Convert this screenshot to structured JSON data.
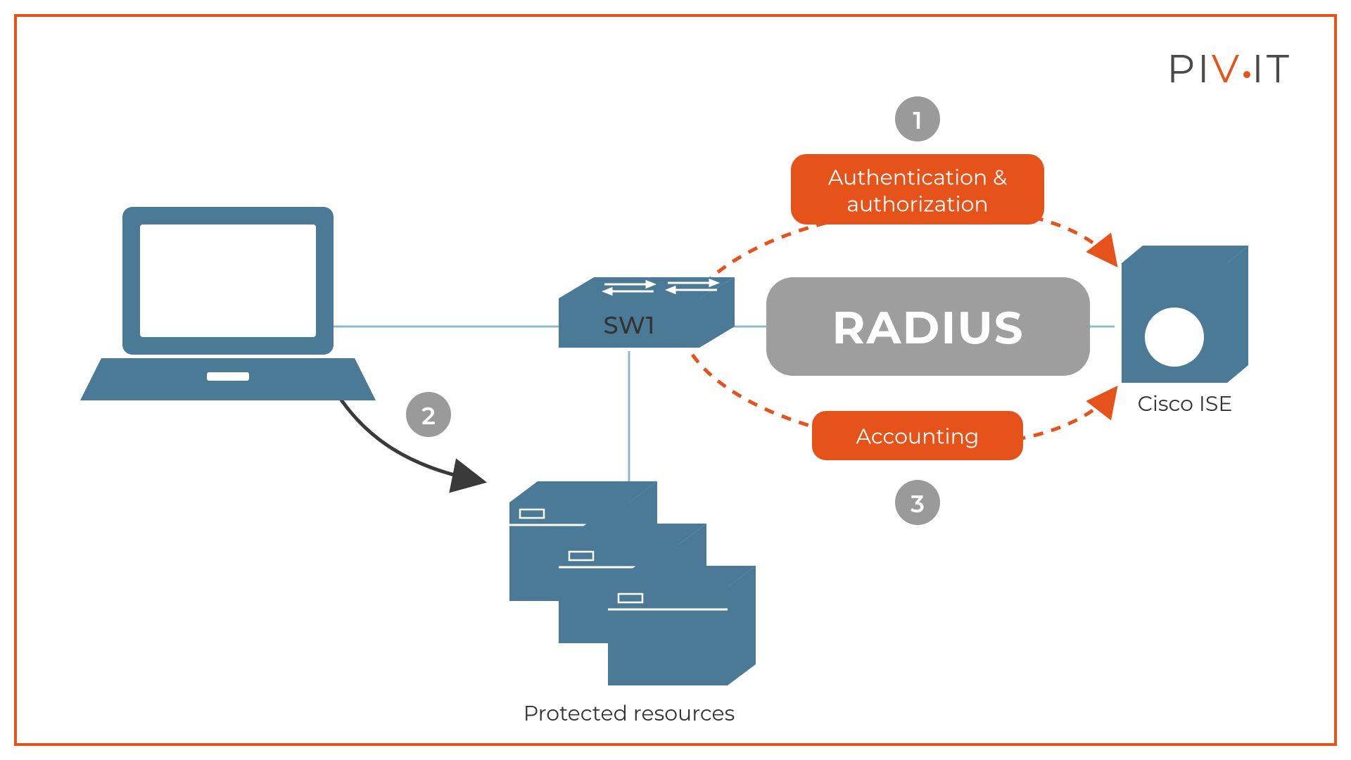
{
  "logo": {
    "p1": "PI",
    "p2": "V",
    "p3": "",
    "p4": "IT"
  },
  "nodes": {
    "switch_label": "SW1",
    "server_label": "Cisco ISE",
    "resources_label": "Protected resources"
  },
  "center_label": "RADIUS",
  "flows": {
    "top": "Authentication &\nauthorization",
    "bottom": "Accounting"
  },
  "steps": {
    "one": "1",
    "two": "2",
    "three": "3"
  },
  "colors": {
    "accent": "#e5531a",
    "blue": "#4a7a96",
    "grey": "#9e9e9e"
  }
}
